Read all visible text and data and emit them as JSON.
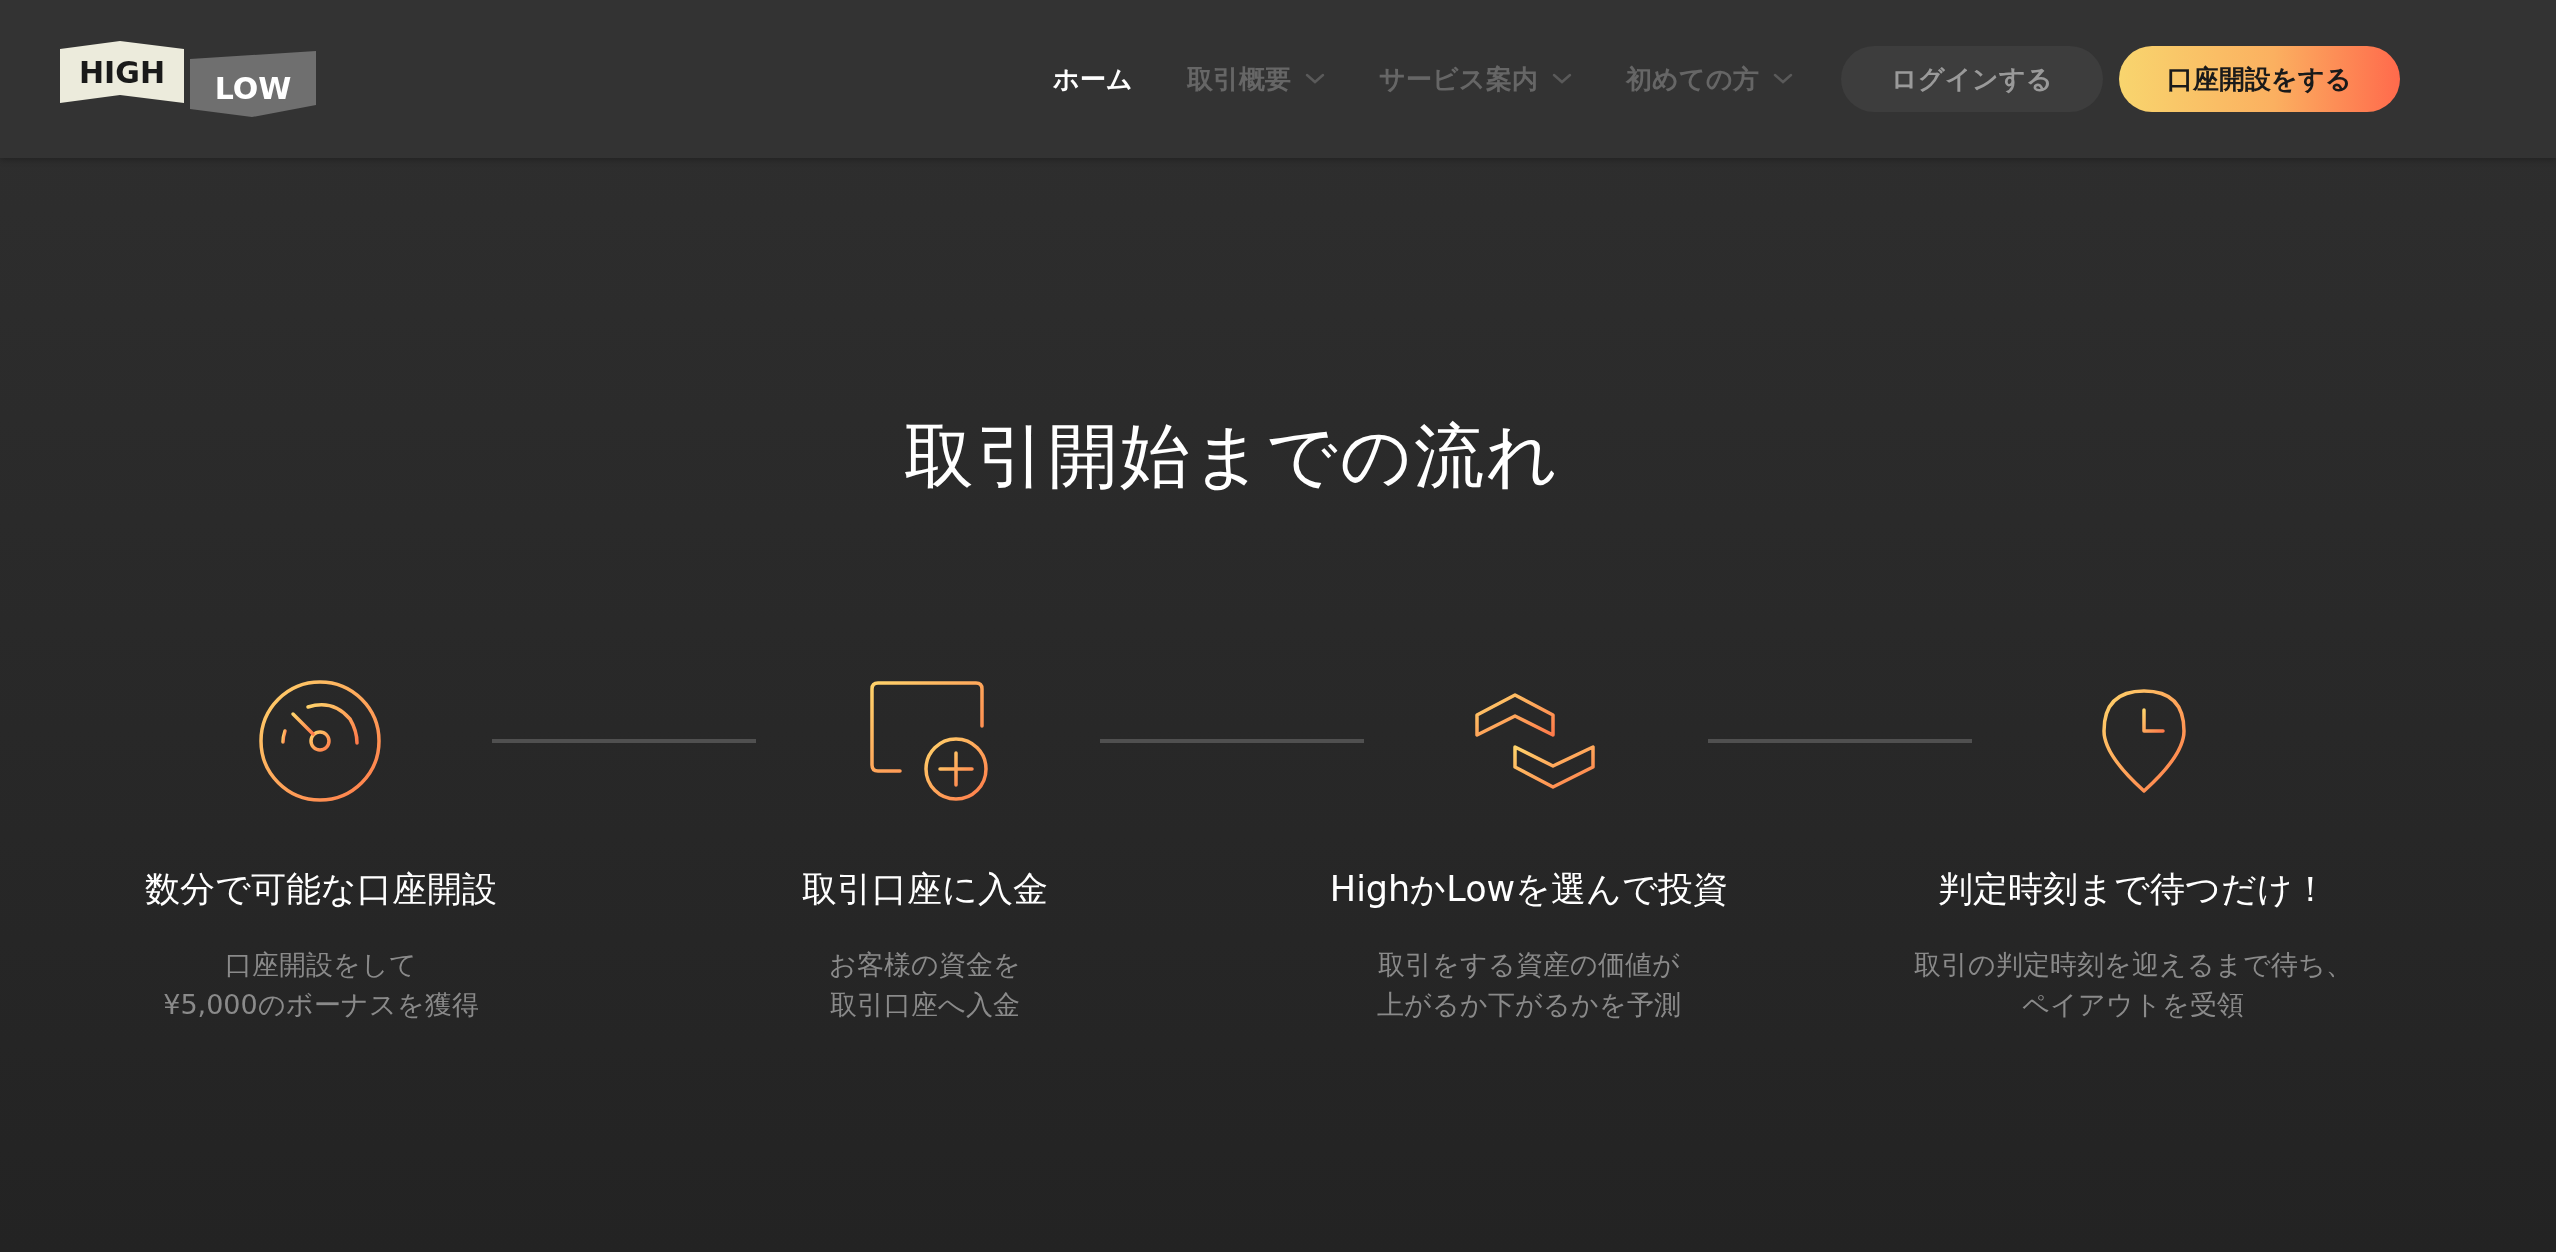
{
  "header": {
    "logo": {
      "left": "HIGH",
      "right": "LOW"
    },
    "nav": [
      {
        "label": "ホーム",
        "selected": true,
        "dropdown": false
      },
      {
        "label": "取引概要",
        "selected": false,
        "dropdown": true
      },
      {
        "label": "サービス案内",
        "selected": false,
        "dropdown": true
      },
      {
        "label": "初めての方",
        "selected": false,
        "dropdown": true
      }
    ],
    "buttons": [
      {
        "label": "ログインする",
        "kind": "secondary"
      },
      {
        "label": "口座開設をする",
        "kind": "primary"
      }
    ]
  },
  "section": {
    "title": "取引開始までの流れ",
    "steps": [
      {
        "kind": "gauge",
        "title": "数分で可能な口座開設",
        "description": [
          "口座開設をして",
          "¥5,000のボーナスを獲得"
        ]
      },
      {
        "kind": "card",
        "title": "取引口座に入金",
        "description": [
          "お客様の資金を",
          "取引口座へ入金"
        ]
      },
      {
        "kind": "chevrons",
        "title": "HighかLowを選んで投資",
        "description": [
          "取引をする資産の価値が",
          "上がるか下がるかを予測"
        ]
      },
      {
        "kind": "pin",
        "title": "判定時刻まで待つだけ！",
        "description": [
          "取引の判定時刻を迎えるまで待ち、",
          "ペイアウトを受領"
        ]
      }
    ]
  }
}
